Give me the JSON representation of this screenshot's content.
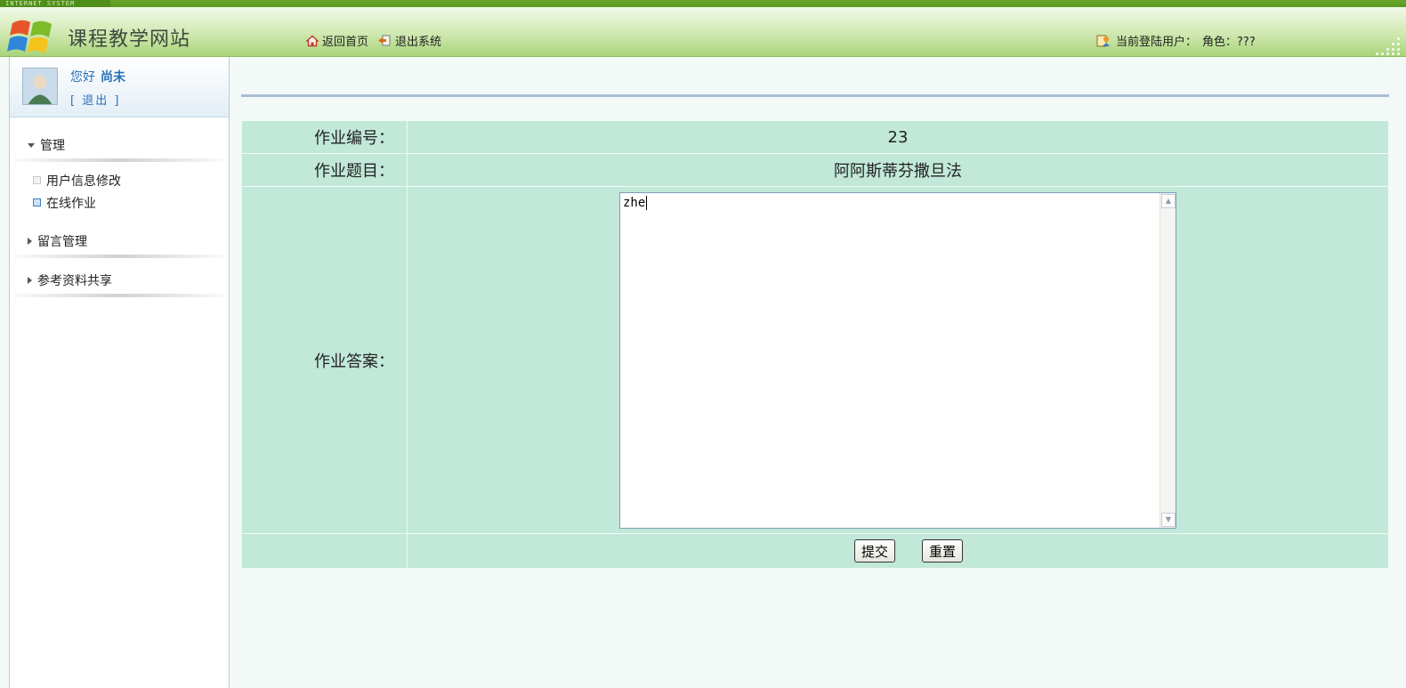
{
  "topband": {
    "tag": "INTERNET SYSTEM"
  },
  "header": {
    "site_title": "课程教学网站",
    "nav": [
      {
        "icon": "home-icon",
        "label": "返回首页"
      },
      {
        "icon": "exit-icon",
        "label": "退出系统"
      }
    ],
    "current_user_label": "当前登陆用户：",
    "role_label": "角色：???"
  },
  "sidebar": {
    "greeting": "您好",
    "username": "尚未",
    "logout": "[ 退出 ]",
    "sections": [
      {
        "label": "管理",
        "expanded": true,
        "items": [
          {
            "label": "用户信息修改",
            "active": false
          },
          {
            "label": "在线作业",
            "active": true
          }
        ]
      },
      {
        "label": "留言管理",
        "expanded": false
      },
      {
        "label": "参考资料共享",
        "expanded": false
      }
    ]
  },
  "form": {
    "id_label": "作业编号：",
    "id_value": "23",
    "title_label": "作业题目：",
    "title_value": "阿阿斯蒂芬撒旦法",
    "answer_label": "作业答案：",
    "answer_value": "zhe",
    "submit_label": "提交",
    "reset_label": "重置"
  },
  "colors": {
    "header_green": "#a9d47a",
    "table_bg": "#c1e8d8",
    "link_blue": "#2b6fb8",
    "rule_blue": "#a8bcd8"
  }
}
